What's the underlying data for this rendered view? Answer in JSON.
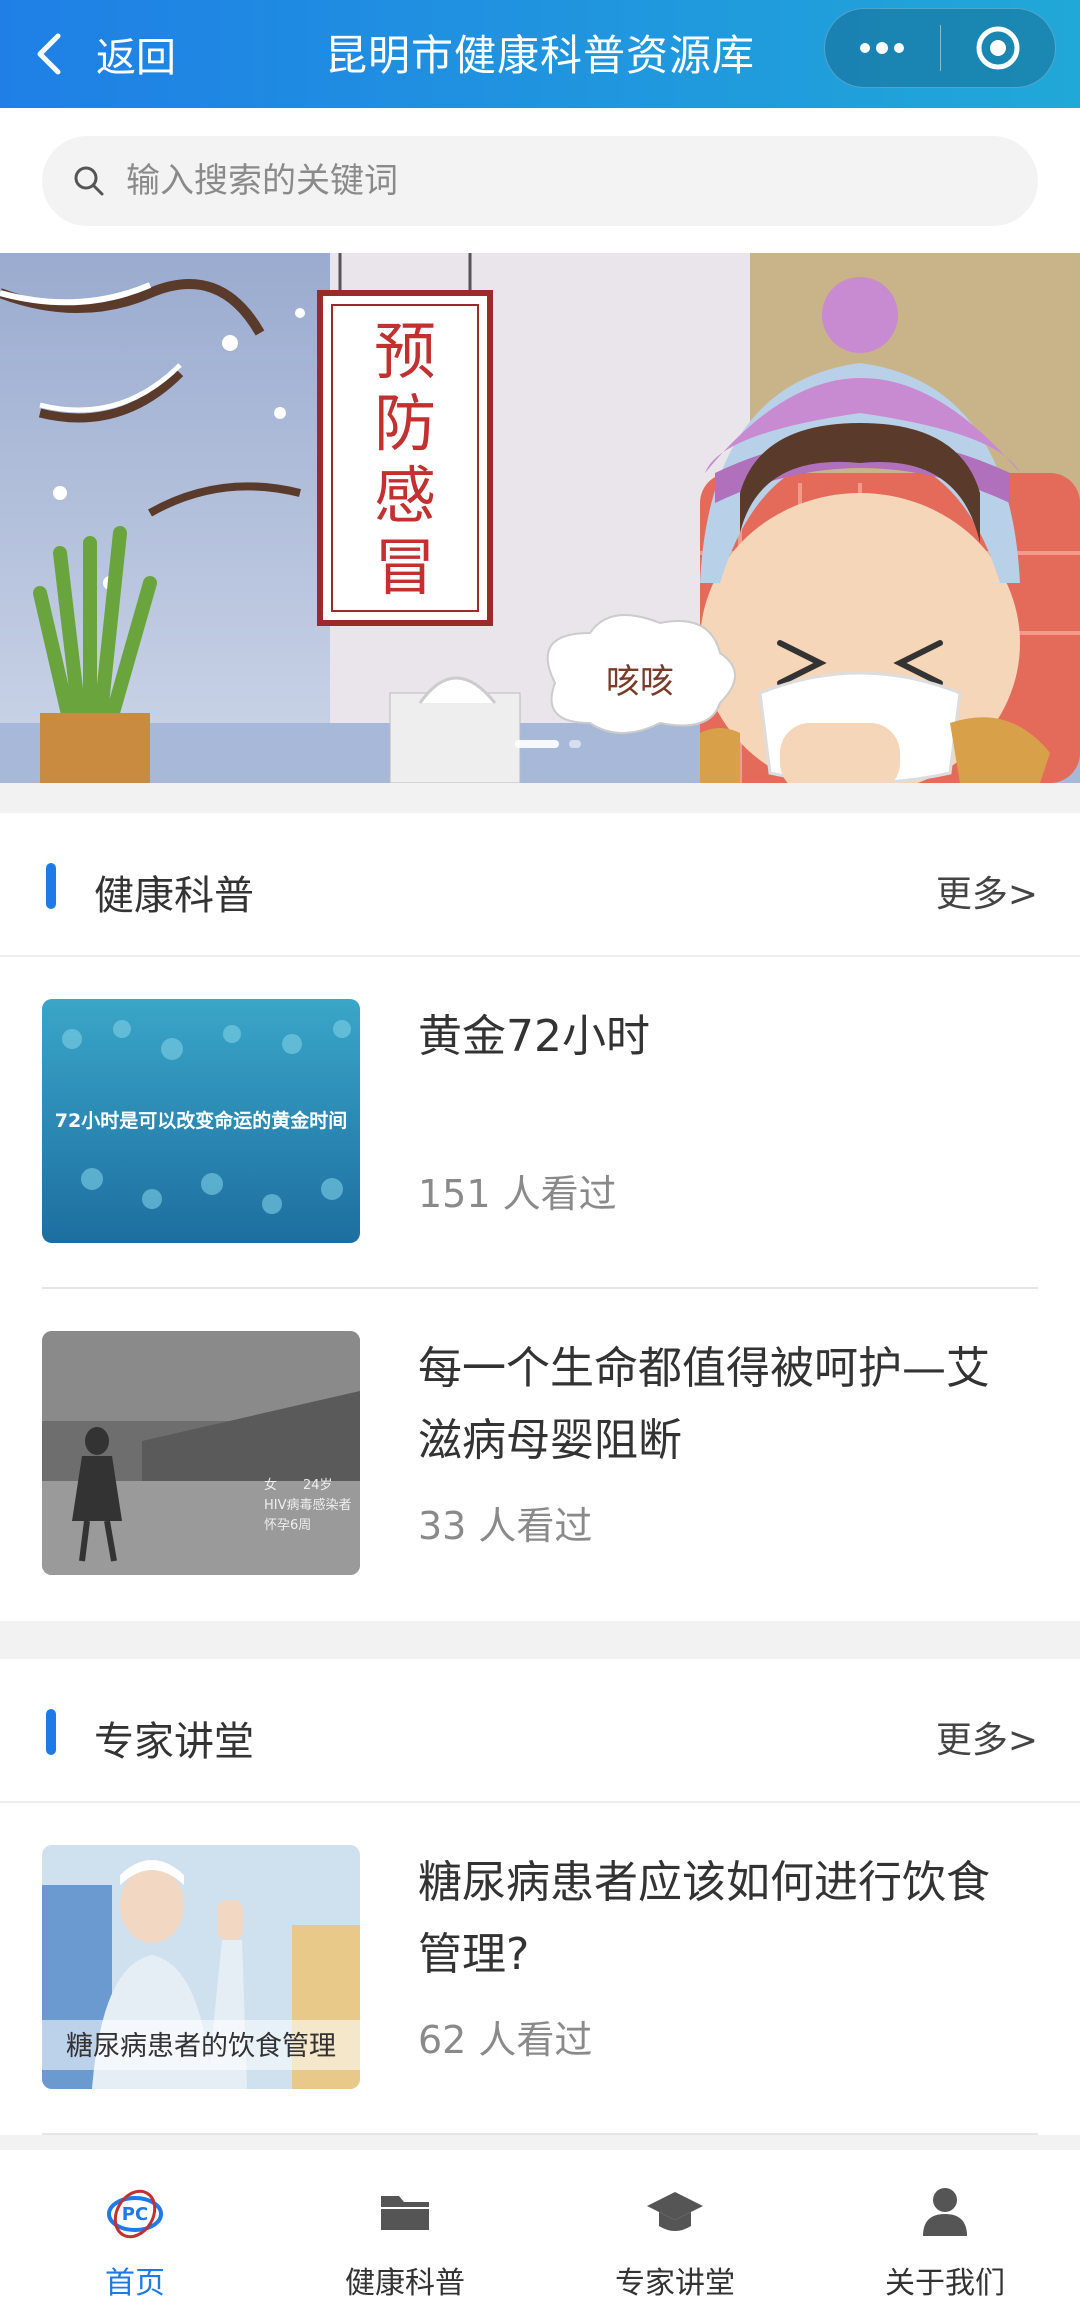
{
  "header": {
    "back_label": "返回",
    "title": "昆明市健康科普资源库"
  },
  "search": {
    "placeholder": "输入搜索的关键词"
  },
  "banner": {
    "sign_text": "预防感冒",
    "bubble_text": "咳咳"
  },
  "sections": [
    {
      "title": "健康科普",
      "more": "更多>",
      "items": [
        {
          "title": "黄金72小时",
          "views": "151 人看过",
          "thumb_caption": "72小时是可以改变命运的黄金时间"
        },
        {
          "title": "每一个生命都值得被呵护—艾滋病母婴阻断",
          "views": "33 人看过",
          "thumb_caption": "女 24岁 HIV病毒感染者 怀孕6周"
        }
      ]
    },
    {
      "title": "专家讲堂",
      "more": "更多>",
      "items": [
        {
          "title": "糖尿病患者应该如何进行饮食管理?",
          "views": "62 人看过",
          "thumb_caption": "糖尿病患者的饮食管理"
        }
      ]
    }
  ],
  "tabbar": [
    {
      "label": "首页",
      "icon": "home-logo-icon",
      "active": true
    },
    {
      "label": "健康科普",
      "icon": "folder-icon",
      "active": false
    },
    {
      "label": "专家讲堂",
      "icon": "graduation-cap-icon",
      "active": false
    },
    {
      "label": "关于我们",
      "icon": "person-icon",
      "active": false
    }
  ],
  "colors": {
    "accent": "#1e7ae6",
    "header_start": "#1f7fe6",
    "header_end": "#20a8d8"
  }
}
